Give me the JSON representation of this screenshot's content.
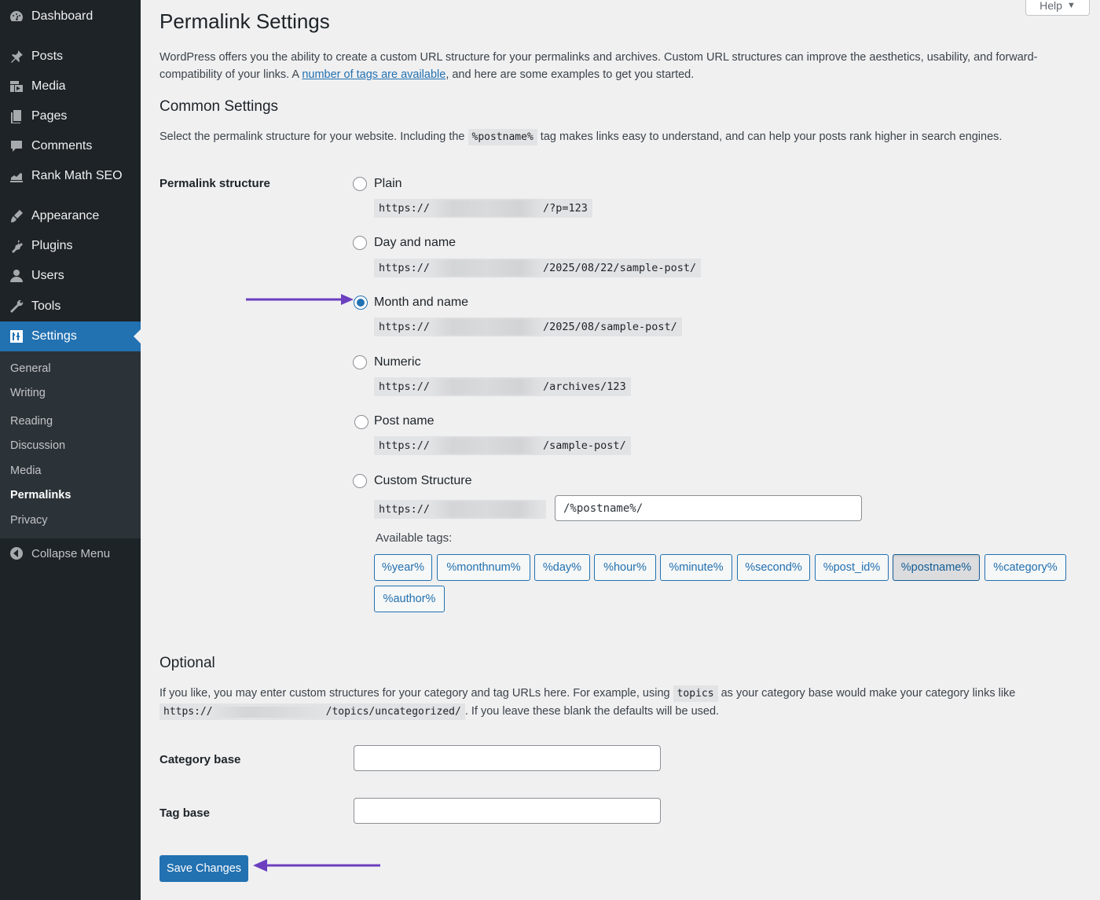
{
  "sidebar": {
    "items": [
      {
        "label": "Dashboard",
        "icon": "dashboard-icon"
      },
      {
        "label": "Posts",
        "icon": "pin-icon"
      },
      {
        "label": "Media",
        "icon": "media-icon"
      },
      {
        "label": "Pages",
        "icon": "pages-icon"
      },
      {
        "label": "Comments",
        "icon": "comment-icon"
      },
      {
        "label": "Rank Math SEO",
        "icon": "chart-icon"
      },
      {
        "label": "Appearance",
        "icon": "brush-icon"
      },
      {
        "label": "Plugins",
        "icon": "plug-icon"
      },
      {
        "label": "Users",
        "icon": "user-icon"
      },
      {
        "label": "Tools",
        "icon": "wrench-icon"
      },
      {
        "label": "Settings",
        "icon": "settings-icon"
      }
    ],
    "submenu": [
      "General",
      "Writing",
      "Reading",
      "Discussion",
      "Media",
      "Permalinks",
      "Privacy"
    ],
    "collapse_label": "Collapse Menu"
  },
  "help_label": "Help",
  "page_title": "Permalink Settings",
  "intro": {
    "before": "WordPress offers you the ability to create a custom URL structure for your permalinks and archives. Custom URL structures can improve the aesthetics, usability, and forward-compatibility of your links. A ",
    "link": "number of tags are available",
    "after": ", and here are some examples to get you started."
  },
  "common": {
    "heading": "Common Settings",
    "desc_before": "Select the permalink structure for your website. Including the ",
    "desc_code": "%postname%",
    "desc_after": " tag makes links easy to understand, and can help your posts rank higher in search engines.",
    "structure_label": "Permalink structure",
    "options": [
      {
        "label": "Plain",
        "prefix": "https://",
        "suffix": "/?p=123"
      },
      {
        "label": "Day and name",
        "prefix": "https://",
        "suffix": "/2025/08/22/sample-post/"
      },
      {
        "label": "Month and name",
        "prefix": "https://",
        "suffix": "/2025/08/sample-post/"
      },
      {
        "label": "Numeric",
        "prefix": "https://",
        "suffix": "/archives/123"
      },
      {
        "label": "Post name",
        "prefix": "https://",
        "suffix": "/sample-post/"
      },
      {
        "label": "Custom Structure",
        "prefix": "https://",
        "suffix": ""
      }
    ],
    "selected": "Month and name",
    "custom_value": "/%postname%/",
    "available_tags_label": "Available tags:",
    "tags": [
      "%year%",
      "%monthnum%",
      "%day%",
      "%hour%",
      "%minute%",
      "%second%",
      "%post_id%",
      "%postname%",
      "%category%",
      "%author%"
    ],
    "active_tag": "%postname%"
  },
  "optional": {
    "heading": "Optional",
    "desc_before": "If you like, you may enter custom structures for your category and tag URLs here. For example, using ",
    "desc_code": "topics",
    "desc_mid": " as your category base would make your category links like",
    "example_prefix": "https://",
    "example_suffix": "/topics/uncategorized/",
    "desc_after": ". If you leave these blank the defaults will be used.",
    "category_base_label": "Category base",
    "category_base_value": "",
    "tag_base_label": "Tag base",
    "tag_base_value": ""
  },
  "save_label": "Save Changes",
  "colors": {
    "sidebar_bg": "#1d2327",
    "accent": "#2271b1",
    "arrow": "#6b3fbf"
  }
}
